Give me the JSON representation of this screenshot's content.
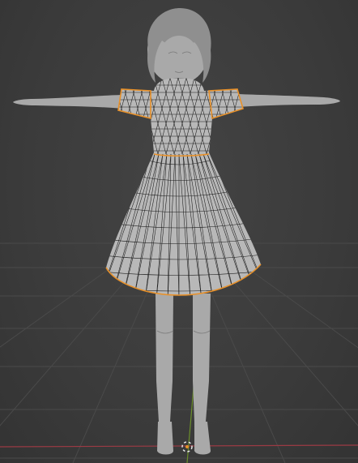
{
  "viewport": {
    "background_color": "#3d3d3d",
    "grid_color": "#4a4a4a",
    "x_axis_color": "#9b3a44",
    "y_axis_color": "#6b8f2a",
    "selection_outline_color": "#e8912a",
    "wireframe_color": "#1b1b1b"
  },
  "scene": {
    "objects": [
      {
        "name": "character-body",
        "mode": "solid"
      },
      {
        "name": "dress-mesh",
        "mode": "wireframe",
        "selected": true
      }
    ],
    "origin_marker": "3d-cursor-icon"
  }
}
